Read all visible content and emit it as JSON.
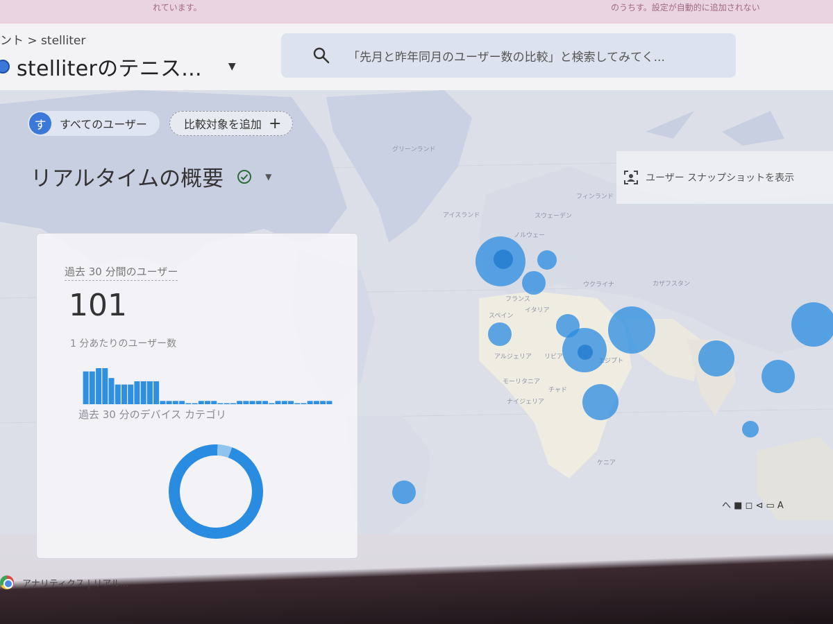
{
  "top_banner": {
    "left_text": "れています。",
    "right_text": "のうちす。設定が自動的に追加されない"
  },
  "header": {
    "breadcrumb": "ント > stelliter",
    "property_name": "stelliterのテニス...",
    "search": {
      "placeholder": "「先月と昨年同月のユーザー数の比較」と検索してみてく..."
    }
  },
  "comparison": {
    "segment_avatar": "す",
    "segment_label": "すべてのユーザー",
    "add_label": "比較対象を追加"
  },
  "report": {
    "title": "リアルタイムの概要"
  },
  "snapshot": {
    "label": "ユーザー スナップショットを表示"
  },
  "card": {
    "title": "過去 30 分間のユーザー",
    "value": "101",
    "per_minute_label": "1 分あたりのユーザー数",
    "device_label": "過去 30 分のデバイス カテゴリ",
    "per_minute_values": [
      10,
      10,
      11,
      11,
      8,
      6,
      6,
      6,
      7,
      7,
      7,
      7,
      1,
      1,
      1,
      1,
      0,
      0,
      1,
      1,
      1,
      0,
      0,
      0,
      1,
      1,
      1,
      1,
      1,
      0,
      1,
      1,
      1,
      0,
      0,
      1,
      1,
      1,
      1
    ],
    "device_share": [
      0.95,
      0.05
    ]
  },
  "map": {
    "labels": [
      "グリーンランド",
      "アイスランド",
      "スウェーデン",
      "フィンランド",
      "ノルウェー",
      "フランス",
      "スペイン",
      "イタリア",
      "ウクライナ",
      "カザフスタン",
      "アルジェリア",
      "リビア",
      "エジプト",
      "モーリタニア",
      "ナイジェリア",
      "チャド",
      "ケニア"
    ],
    "bubbles": [
      {
        "region": "英国周辺",
        "size": 3
      },
      {
        "region": "スカンジナビア",
        "size": 1
      },
      {
        "region": "ドイツ",
        "size": 1
      },
      {
        "region": "スペイン",
        "size": 1
      },
      {
        "region": "イタリア",
        "size": 1
      },
      {
        "region": "ギリシャ",
        "size": 2
      },
      {
        "region": "トルコ",
        "size": 2
      },
      {
        "region": "エジプト",
        "size": 2
      },
      {
        "region": "アフリカ中央",
        "size": 2
      },
      {
        "region": "インド",
        "size": 2
      },
      {
        "region": "東南アジア",
        "size": 2
      },
      {
        "region": "中国",
        "size": 3
      },
      {
        "region": "インドネシア",
        "size": 1
      },
      {
        "region": "ブラジル",
        "size": 1
      }
    ]
  },
  "taskbar": {
    "tab_label": "アナリティクス | リアル...",
    "tray_text": "へ ■ ◻ ⊲ ▭ A"
  },
  "colors": {
    "accent": "#3b78d8",
    "bubble": "#2a8ce0",
    "map_bg": "#dcdfe7",
    "land": "#f1eee3"
  }
}
